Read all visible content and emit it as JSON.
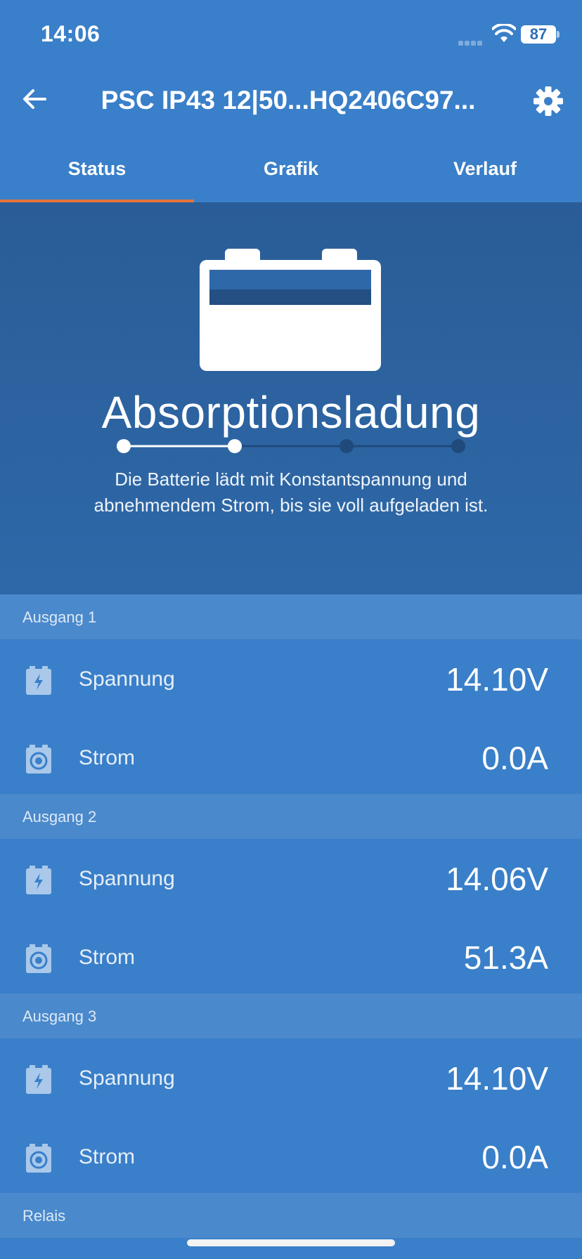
{
  "status_bar": {
    "time": "14:06",
    "battery_level": "87"
  },
  "header": {
    "title": "PSC IP43 12|50...HQ2406C97...",
    "back_icon": "arrow-left-icon",
    "settings_icon": "gear-icon"
  },
  "tabs": [
    {
      "label": "Status",
      "active": true
    },
    {
      "label": "Grafik",
      "active": false
    },
    {
      "label": "Verlauf",
      "active": false
    }
  ],
  "charge_state": {
    "title": "Absorptionsladung",
    "description_line1": "Die Batterie lädt mit Konstantspannung und",
    "description_line2": "abnehmendem Strom, bis sie voll aufgeladen ist.",
    "step_current": 2,
    "step_total": 4
  },
  "outputs": [
    {
      "name": "Ausgang 1",
      "voltage_label": "Spannung",
      "voltage_value": "14.10V",
      "current_label": "Strom",
      "current_value": "0.0A"
    },
    {
      "name": "Ausgang 2",
      "voltage_label": "Spannung",
      "voltage_value": "14.06V",
      "current_label": "Strom",
      "current_value": "51.3A"
    },
    {
      "name": "Ausgang 3",
      "voltage_label": "Spannung",
      "voltage_value": "14.10V",
      "current_label": "Strom",
      "current_value": "0.0A"
    }
  ],
  "relay": {
    "name": "Relais"
  },
  "colors": {
    "primary": "#3a7fc9",
    "hero": "#2a5d97",
    "section_header": "#4a89cb",
    "tab_indicator": "#e8743b",
    "progress_inactive": "#1f4a7a"
  }
}
